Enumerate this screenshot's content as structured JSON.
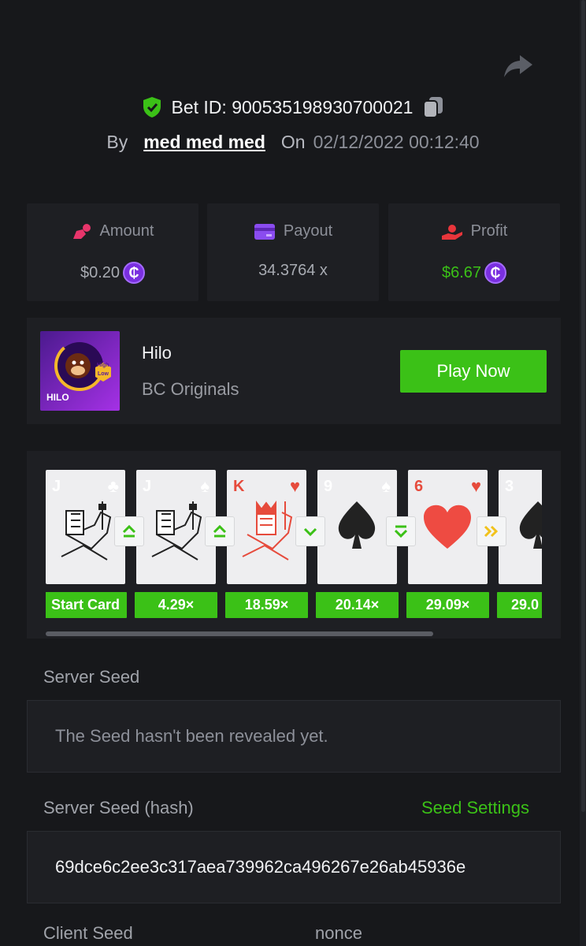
{
  "header": {
    "bet_id": "Bet ID: 900535198930700021",
    "by_label": "By",
    "user": "med med med",
    "on_label": "On",
    "date": "02/12/2022 00:12:40"
  },
  "stats": {
    "amount": {
      "label": "Amount",
      "value": "$0.20"
    },
    "payout": {
      "label": "Payout",
      "value": "34.3764 x"
    },
    "profit": {
      "label": "Profit",
      "value": "$6.67"
    },
    "coin_glyph": "₵"
  },
  "game": {
    "title": "Hilo",
    "provider": "BC Originals",
    "play_label": "Play Now",
    "thumb_label": "HILO",
    "thumb_badge": [
      "High",
      "Low"
    ]
  },
  "cards": [
    {
      "rank": "J",
      "suit": "♣",
      "color": "#222",
      "multiplier": "Start Card"
    },
    {
      "rank": "J",
      "suit": "♠",
      "color": "#222",
      "multiplier": "4.29×",
      "guess": "higher"
    },
    {
      "rank": "K",
      "suit": "♥",
      "color": "#e64b3c",
      "multiplier": "18.59×",
      "guess": "higher"
    },
    {
      "rank": "9",
      "suit": "♠",
      "color": "#222",
      "multiplier": "20.14×",
      "guess": "lower"
    },
    {
      "rank": "6",
      "suit": "♥",
      "color": "#e64b3c",
      "multiplier": "29.09×",
      "guess": "lower-or-equal"
    },
    {
      "rank": "3",
      "suit": "♠",
      "color": "#222",
      "multiplier": "29.0",
      "guess": "skip"
    }
  ],
  "server_seed": {
    "label": "Server Seed",
    "value": "The Seed hasn't been revealed yet."
  },
  "server_seed_hash": {
    "label": "Server Seed (hash)",
    "settings_link": "Seed Settings",
    "value": "69dce6c2ee3c317aea739962ca496267e26ab45936e"
  },
  "footer_labels": {
    "client_seed": "Client Seed",
    "nonce": "nonce"
  },
  "colors": {
    "accent_green": "#3bc117",
    "coin_purple": "#7a2fe0",
    "heart_red": "#e64b3c",
    "background": "#17181b",
    "panel": "#1e1f23"
  }
}
